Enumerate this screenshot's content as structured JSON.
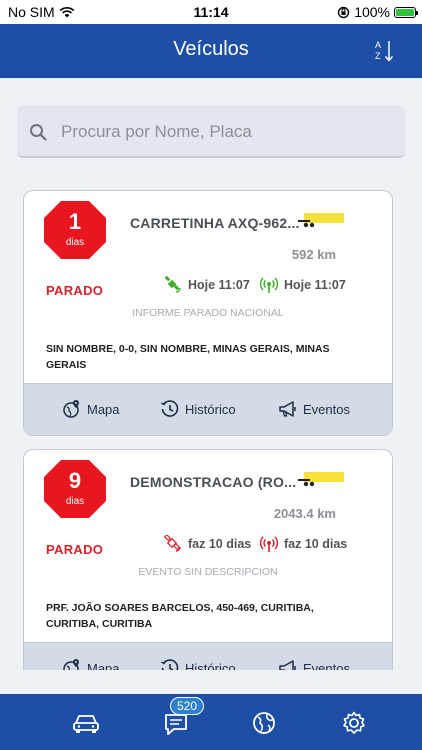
{
  "status_bar": {
    "carrier": "No SIM",
    "time": "11:14",
    "battery": "100%"
  },
  "header": {
    "title": "Veículos",
    "sort_icon": "sort-az-icon"
  },
  "search": {
    "placeholder": "Procura por Nome, Placa"
  },
  "vehicles": [
    {
      "days_number": "1",
      "days_label": "dias",
      "name": "CARRETINHA AXQ-962...",
      "distance": "592 km",
      "status": "PARADO",
      "gps_time": "Hoje 11:07",
      "signal_time": "Hoje 11:07",
      "description": "INFORME PARADO NACIONAL",
      "address": "SIN NOMBRE, 0-0, SIN NOMBRE, MINAS GERAIS, MINAS GERAIS",
      "actions": {
        "map": "Mapa",
        "history": "Histórico",
        "events": "Eventos"
      }
    },
    {
      "days_number": "9",
      "days_label": "dias",
      "name": "DEMONSTRACAO (RO...",
      "distance": "2043.4 km",
      "status": "PARADO",
      "gps_time": "faz 10 dias",
      "signal_time": "faz 10 dias",
      "description": "EVENTO SIN DESCRIPCION",
      "address": "PRF. JOÃO SOARES BARCELOS, 450-469, CURITIBA, CURITIBA, CURITIBA",
      "actions": {
        "map": "Mapa",
        "history": "Histórico",
        "events": "Eventos"
      }
    }
  ],
  "tabbar": {
    "messages_count": "520"
  },
  "colors": {
    "primary": "#1d4fa6",
    "danger": "#d9232b",
    "ok": "#3fae2a",
    "highlight": "#f5e13a"
  }
}
